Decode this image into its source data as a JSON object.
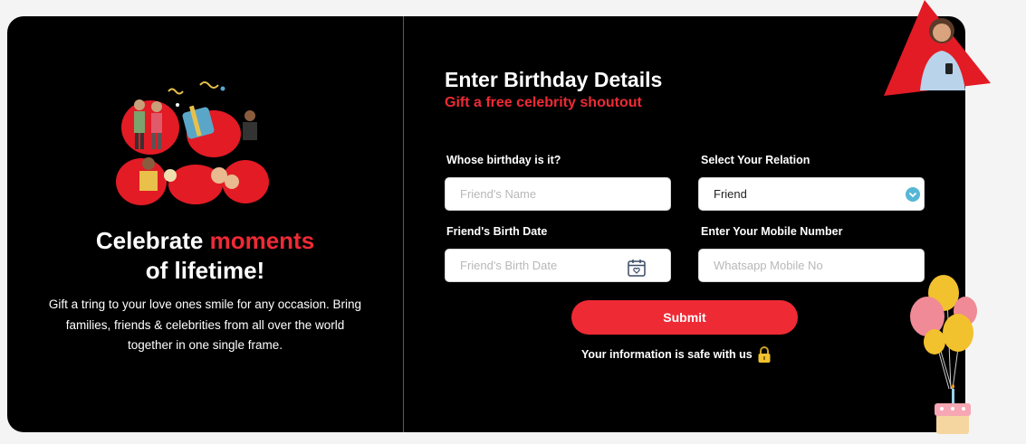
{
  "left": {
    "headline_start": "Celebrate ",
    "headline_highlight": "moments",
    "headline_end": "of lifetime!",
    "paragraph": "Gift a tring to your love ones smile for any occasion. Bring families, friends & celebrities from all over the world together in one single frame."
  },
  "form": {
    "title": "Enter Birthday Details",
    "subtitle": "Gift a free celebrity shoutout",
    "whose_birthday_label": "Whose birthday is it?",
    "friend_name_placeholder": "Friend's Name",
    "relation_label": "Select Your Relation",
    "relation_value": "Friend",
    "birth_date_label": "Friend's Birth Date",
    "birth_date_placeholder": "Friend's Birth Date",
    "mobile_label": "Enter Your Mobile Number",
    "mobile_placeholder": "Whatsapp Mobile No",
    "submit_label": "Submit",
    "safe_text": "Your information is safe with us"
  },
  "colors": {
    "accent": "#ee2a35",
    "background": "#000000",
    "page": "#f4f4f4"
  },
  "icons": {
    "calendar": "calendar-heart-icon",
    "dropdown": "chevron-down-icon",
    "lock": "lock-icon"
  }
}
